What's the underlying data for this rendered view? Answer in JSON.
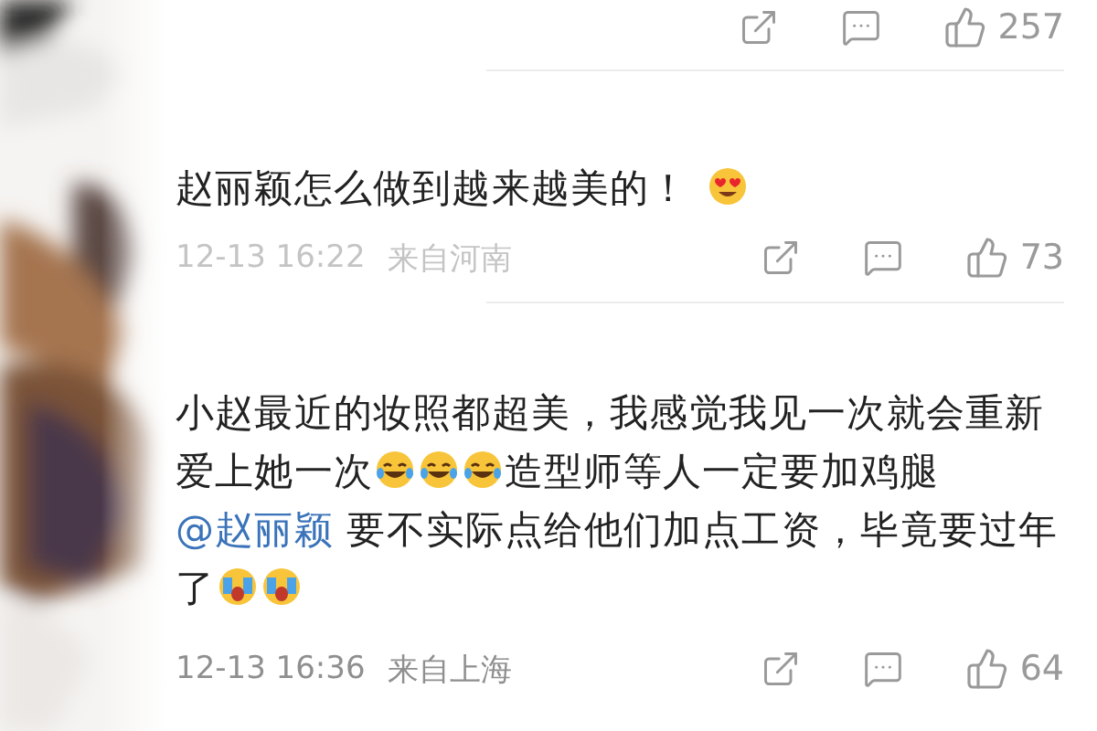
{
  "top_actions": {
    "likes": "257"
  },
  "comments": [
    {
      "segments": [
        {
          "kind": "text",
          "text": "赵丽颖怎么做到越来越美的！"
        },
        {
          "kind": "heart-eyes"
        }
      ],
      "time": "12-13 16:22",
      "location": "来自河南",
      "likes": "73"
    },
    {
      "segments": [
        {
          "kind": "text",
          "text": "小赵最近的妆照都超美，我感觉我见一次就会重新爱上她一次"
        },
        {
          "kind": "tears-of-joy"
        },
        {
          "kind": "tears-of-joy"
        },
        {
          "kind": "tears-of-joy"
        },
        {
          "kind": "text",
          "text": "造型师等人一定要加鸡腿"
        },
        {
          "kind": "mention",
          "text": "@赵丽颖"
        },
        {
          "kind": "text",
          "text": " 要不实际点给他们加点工资，毕竟要过年了"
        },
        {
          "kind": "scream"
        },
        {
          "kind": "scream"
        }
      ],
      "time": "12-13 16:36",
      "location": "来自上海",
      "likes": "64"
    }
  ]
}
